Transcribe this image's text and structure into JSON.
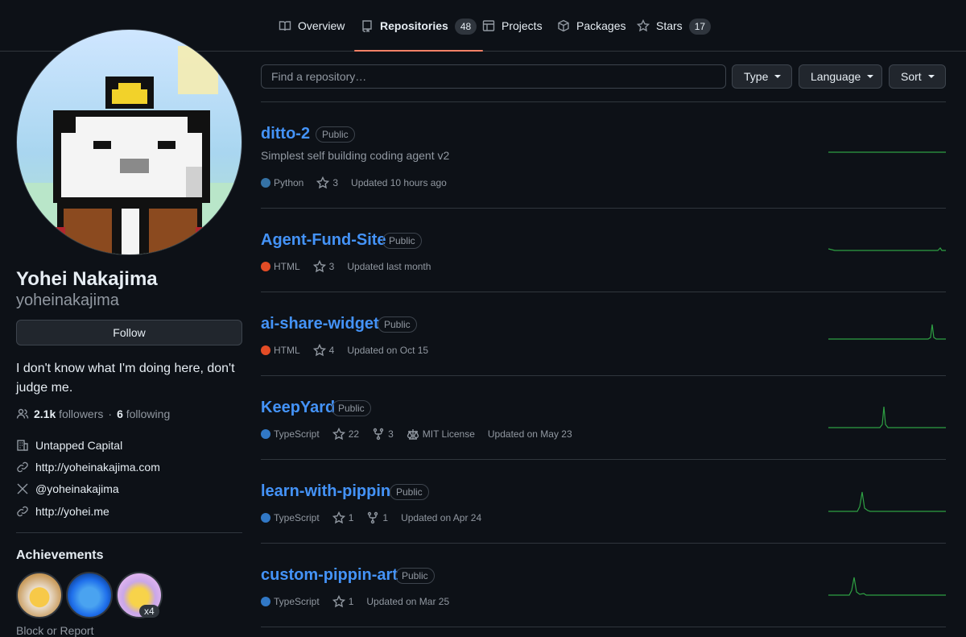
{
  "nav": {
    "tabs": [
      {
        "label": "Overview",
        "icon": "book-icon"
      },
      {
        "label": "Repositories",
        "count": "48",
        "icon": "repo-icon"
      },
      {
        "label": "Projects",
        "icon": "table-icon"
      },
      {
        "label": "Packages",
        "icon": "package-icon"
      },
      {
        "label": "Stars",
        "count": "17",
        "icon": "star-icon"
      }
    ]
  },
  "profile": {
    "name": "Yohei Nakajima",
    "login": "yoheinakajima",
    "follow_label": "Follow",
    "bio": "I don't know what I'm doing here, don't judge me.",
    "followers_count": "2.1k",
    "followers_label": "followers",
    "separator": "·",
    "following_count": "6",
    "following_label": "following",
    "company": "Untapped Capital",
    "website": "http://yoheinakajima.com",
    "twitter": "@yoheinakajima",
    "link2": "http://yohei.me",
    "achievements_title": "Achievements",
    "achievement_multiplier": "x4",
    "block_label": "Block or Report"
  },
  "filters": {
    "search_placeholder": "Find a repository…",
    "type_label": "Type",
    "language_label": "Language",
    "sort_label": "Sort"
  },
  "colors": {
    "python": "#3572A5",
    "html": "#e34c26",
    "typescript": "#3178c6",
    "accent": "#f78166",
    "link": "#4493f8",
    "spark": "#2ea043"
  },
  "repos": [
    {
      "name": "ditto-2",
      "visibility": "Public",
      "description": "Simplest self building coding agent v2",
      "language": "Python",
      "stars": "3",
      "updated": "Updated 10 hours ago"
    },
    {
      "name": "Agent-Fund-Site",
      "visibility": "Public",
      "language": "HTML",
      "stars": "3",
      "updated": "Updated last month"
    },
    {
      "name": "ai-share-widget",
      "visibility": "Public",
      "language": "HTML",
      "stars": "4",
      "updated": "Updated on Oct 15"
    },
    {
      "name": "KeepYard",
      "visibility": "Public",
      "language": "TypeScript",
      "stars": "22",
      "forks": "3",
      "license": "MIT License",
      "updated": "Updated on May 23"
    },
    {
      "name": "learn-with-pippin",
      "visibility": "Public",
      "language": "TypeScript",
      "stars": "1",
      "forks": "1",
      "updated": "Updated on Apr 24"
    },
    {
      "name": "custom-pippin-art",
      "visibility": "Public",
      "language": "TypeScript",
      "stars": "1",
      "updated": "Updated on Mar 25"
    }
  ]
}
